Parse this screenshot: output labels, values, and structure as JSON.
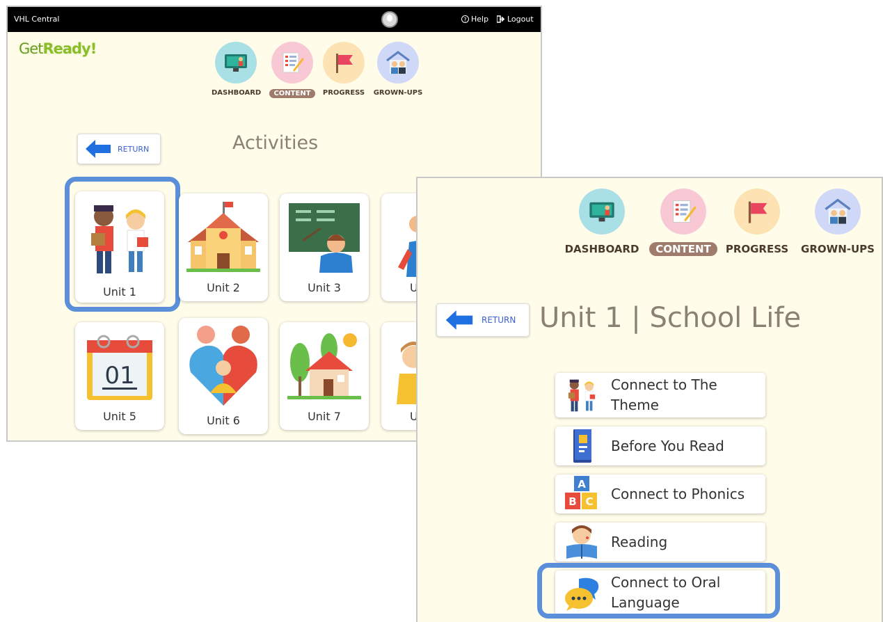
{
  "screen1": {
    "topbar": {
      "brand": "VHL Central",
      "help": "Help",
      "logout": "Logout"
    },
    "logo": {
      "get": "Get",
      "ready": "Ready!"
    },
    "nav": [
      {
        "label": "DASHBOARD",
        "icon": "dashboard-icon",
        "color": "#a8e0e6",
        "active": false
      },
      {
        "label": "CONTENT",
        "icon": "content-icon",
        "color": "#f8c9d4",
        "active": true
      },
      {
        "label": "PROGRESS",
        "icon": "progress-icon",
        "color": "#fde3b3",
        "active": false
      },
      {
        "label": "GROWN-UPS",
        "icon": "grown-ups-icon",
        "color": "#cfd9f7",
        "active": false
      }
    ],
    "return_label": "RETURN",
    "title": "Activities",
    "units": [
      "Unit 1",
      "Unit 2",
      "Unit 3",
      "U",
      "Unit 5",
      "Unit 6",
      "Unit 7",
      "U"
    ]
  },
  "screen2": {
    "nav": [
      {
        "label": "DASHBOARD",
        "icon": "dashboard-icon",
        "active": false
      },
      {
        "label": "CONTENT",
        "icon": "content-icon",
        "active": true
      },
      {
        "label": "PROGRESS",
        "icon": "progress-icon",
        "active": false
      },
      {
        "label": "GROWN-UPS",
        "icon": "grown-ups-icon",
        "active": false
      }
    ],
    "return_label": "RETURN",
    "title": "Unit 1 | School Life",
    "activities": [
      {
        "line1": "Connect to The",
        "line2": "Theme",
        "icon": "students-icon"
      },
      {
        "line1": "Before You Read",
        "line2": "",
        "icon": "book-icon"
      },
      {
        "line1": "Connect to Phonics",
        "line2": "",
        "icon": "abc-blocks-icon"
      },
      {
        "line1": "Reading",
        "line2": "",
        "icon": "reading-child-icon"
      },
      {
        "line1": "Connect to Oral",
        "line2": "Language",
        "icon": "speech-bubbles-icon"
      }
    ]
  },
  "colors": {
    "accent_highlight": "#5b8fd9",
    "background": "#fffcea",
    "return_blue": "#1f6fe0",
    "active_tab": "#9e7b6b"
  }
}
